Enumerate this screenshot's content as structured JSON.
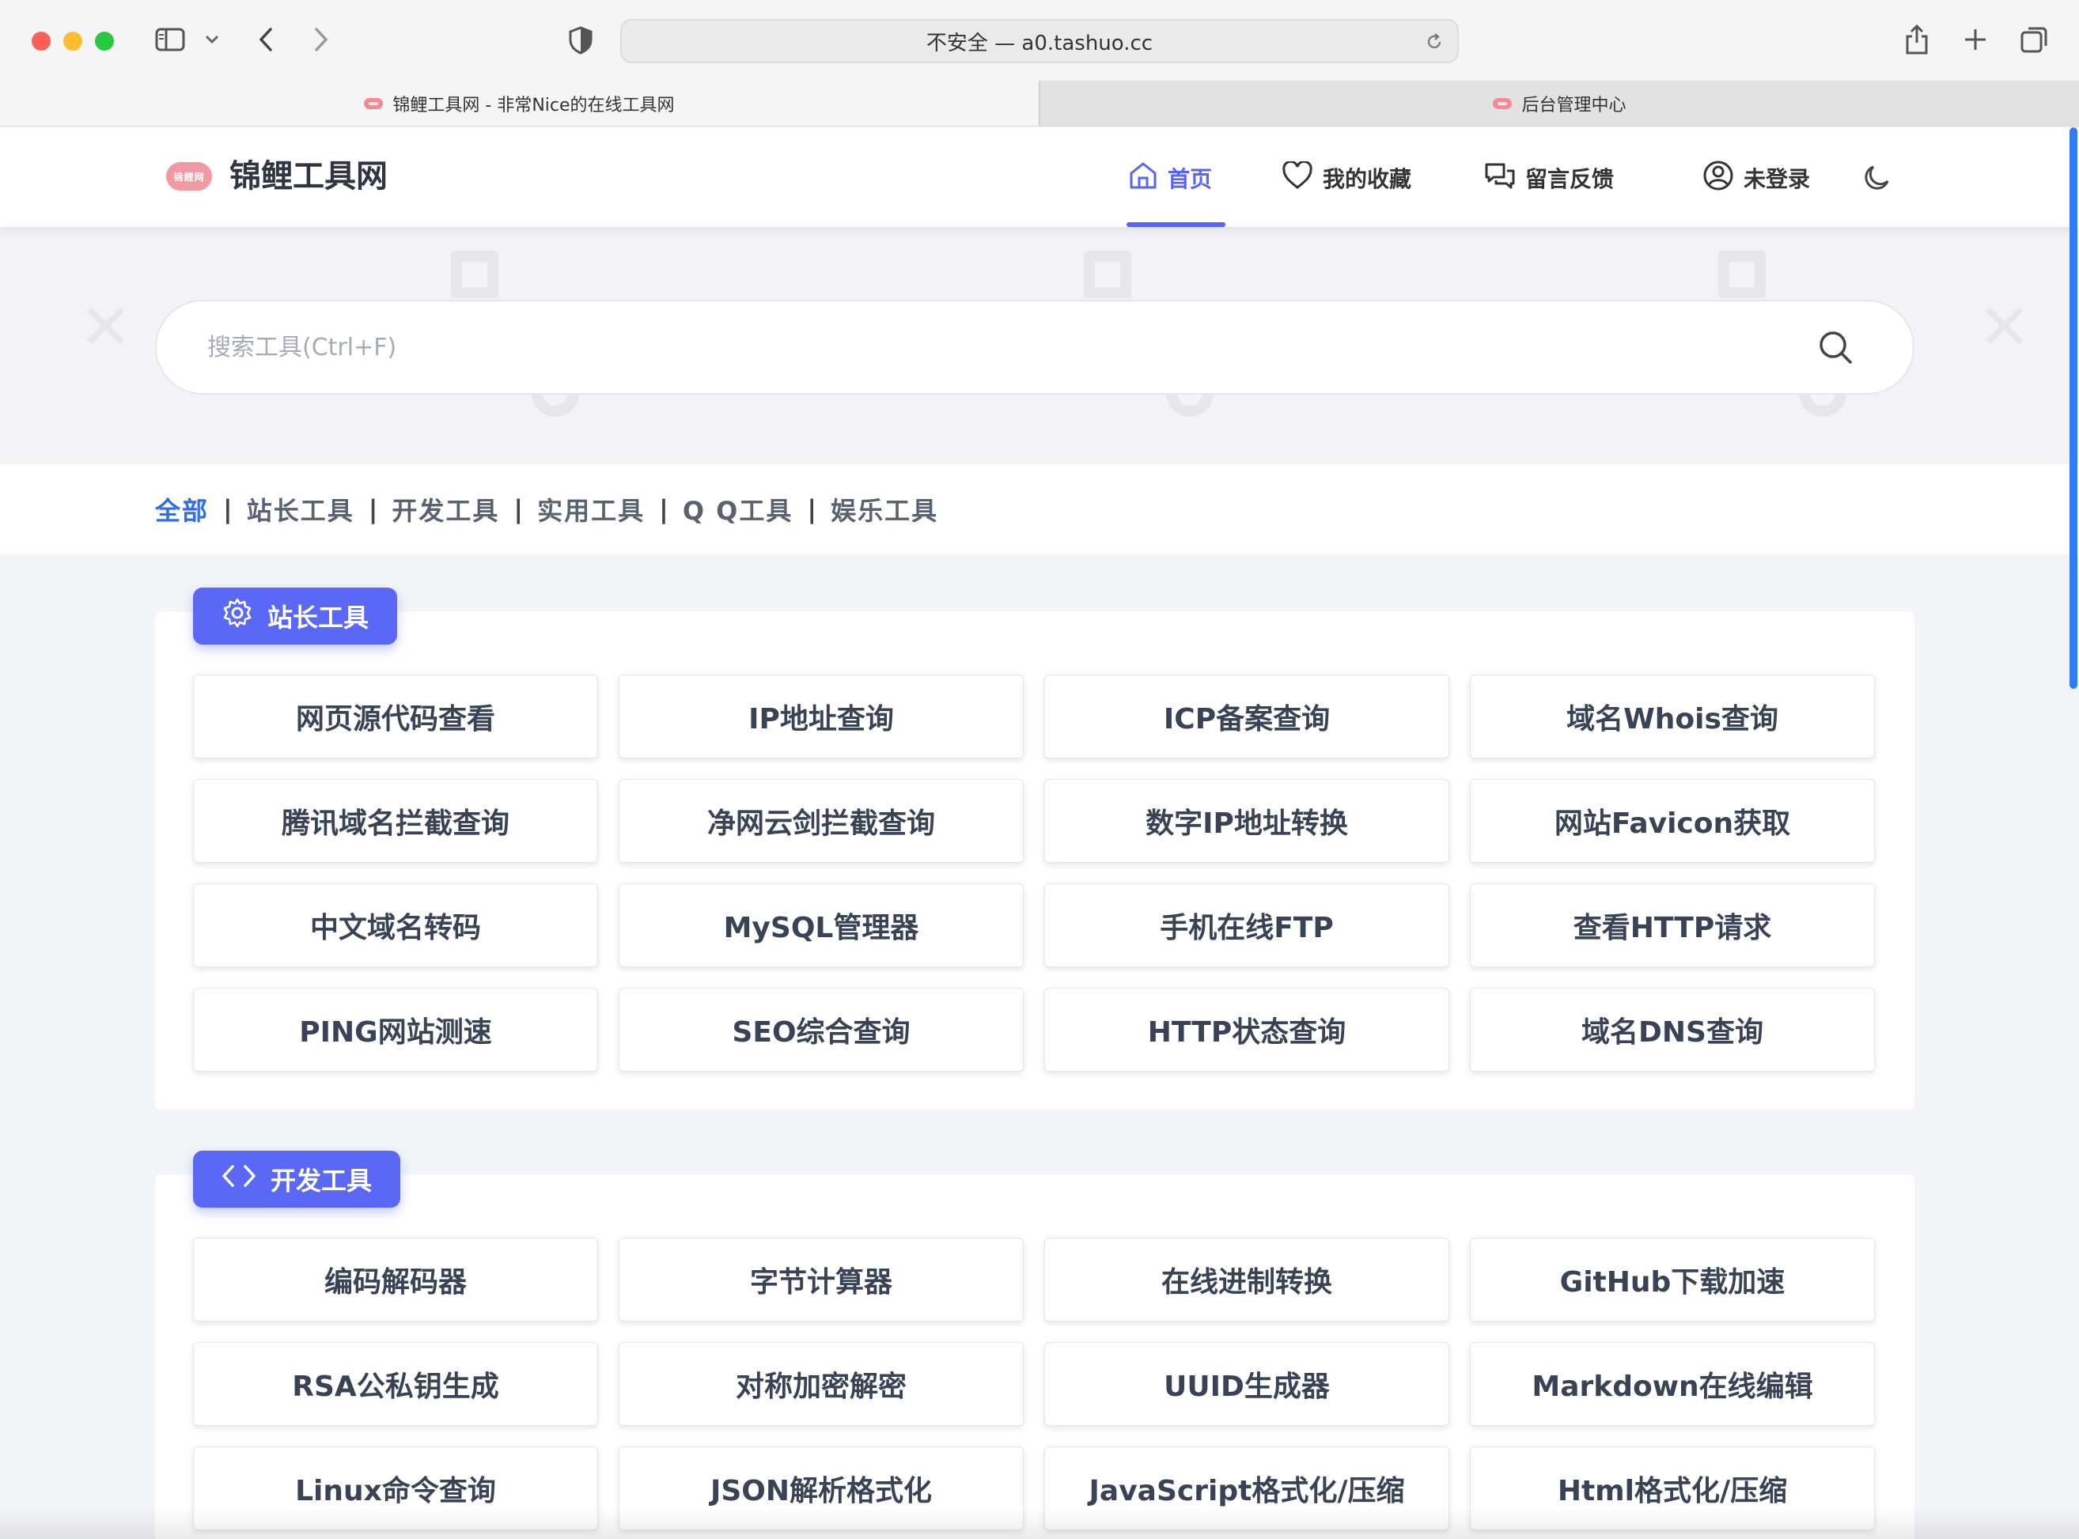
{
  "browser": {
    "address": "不安全 — a0.tashuo.cc",
    "tabs": [
      {
        "title": "锦鲤工具网 - 非常Nice的在线工具网",
        "active": true
      },
      {
        "title": "后台管理中心",
        "active": false
      }
    ]
  },
  "header": {
    "logo_text": "锦鲤网",
    "site_name": "锦鲤工具网",
    "nav": {
      "home": "首页",
      "favorites": "我的收藏",
      "feedback": "留言反馈",
      "login": "未登录"
    },
    "accent": "#5863f8"
  },
  "search": {
    "placeholder": "搜索工具(Ctrl+F)",
    "value": ""
  },
  "categories": {
    "all": "全部",
    "webmaster": "站长工具",
    "dev": "开发工具",
    "utility": "实用工具",
    "qq": "Q Q工具",
    "fun": "娱乐工具",
    "sep": "|"
  },
  "sections": [
    {
      "title": "站长工具",
      "icon": "gear-icon",
      "tools": [
        "网页源代码查看",
        "IP地址查询",
        "ICP备案查询",
        "域名Whois查询",
        "腾讯域名拦截查询",
        "净网云剑拦截查询",
        "数字IP地址转换",
        "网站Favicon获取",
        "中文域名转码",
        "MySQL管理器",
        "手机在线FTP",
        "查看HTTP请求",
        "PING网站测速",
        "SEO综合查询",
        "HTTP状态查询",
        "域名DNS查询"
      ]
    },
    {
      "title": "开发工具",
      "icon": "code-icon",
      "tools": [
        "编码解码器",
        "字节计算器",
        "在线进制转换",
        "GitHub下载加速",
        "RSA公私钥生成",
        "对称加密解密",
        "UUID生成器",
        "Markdown在线编辑",
        "Linux命令查询",
        "JSON解析格式化",
        "JavaScript格式化/压缩",
        "Html格式化/压缩"
      ]
    }
  ]
}
